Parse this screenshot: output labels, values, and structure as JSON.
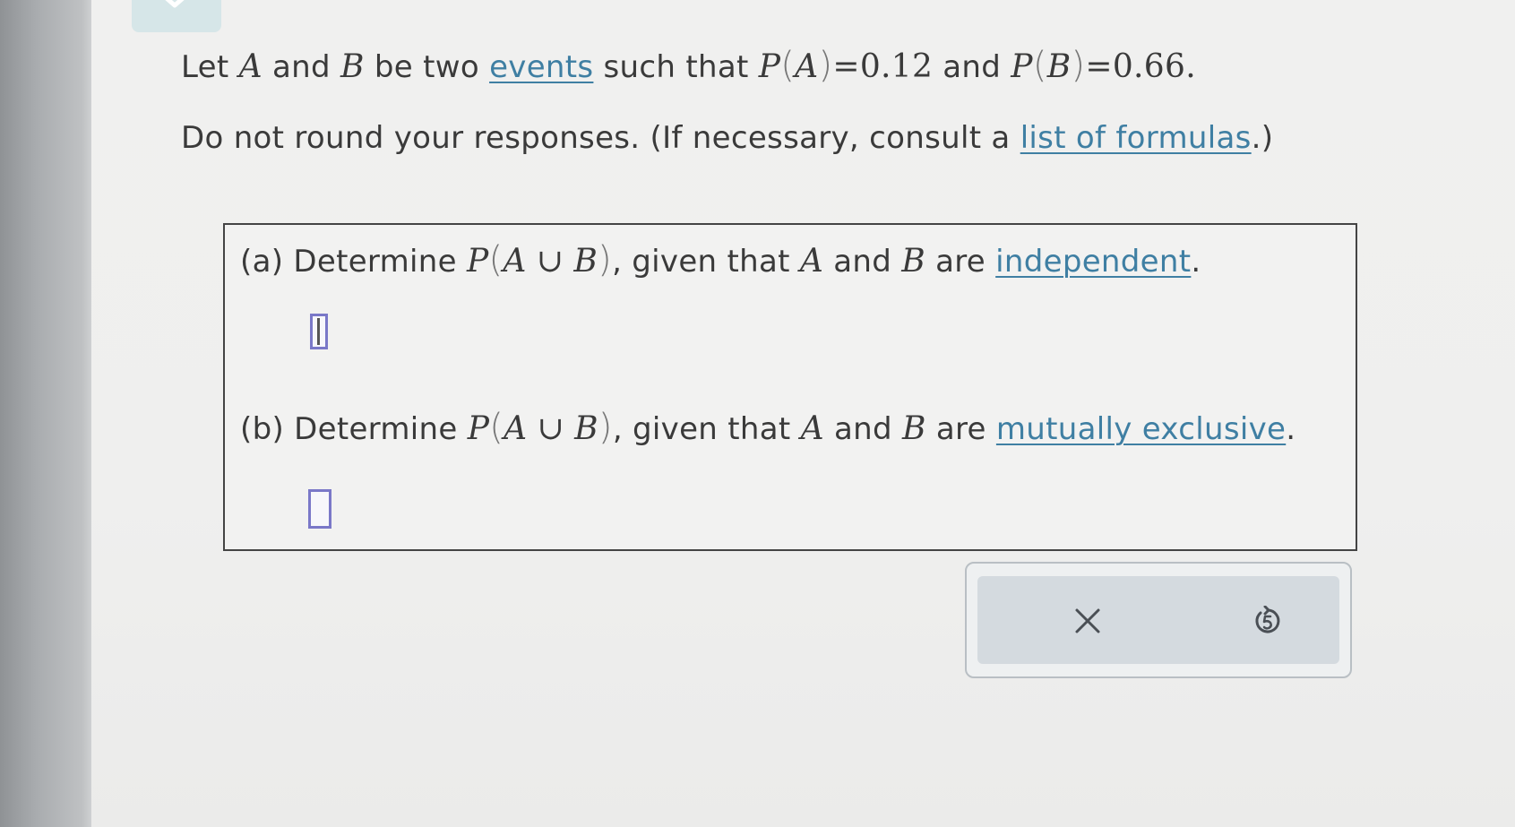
{
  "intro": {
    "let": "Let",
    "var_a": "A",
    "and1": "and",
    "var_b": "B",
    "be_two": "be two",
    "events_link": "events",
    "such_that": "such that",
    "pa_p": "P",
    "pa_a": "A",
    "pa_eq": "=0.12",
    "and2": "and",
    "pb_p": "P",
    "pb_b": "B",
    "pb_eq": "=0.66."
  },
  "instruction": {
    "text": "Do not round your responses. (If necessary, consult a",
    "formulas_link": "list of formulas",
    "tail": ".)"
  },
  "part_a": {
    "label": "(a)",
    "determine": "Determine",
    "p": "P",
    "a": "A",
    "union": "∪",
    "b": "B",
    "given": ", given that",
    "var_a": "A",
    "and": "and",
    "var_b": "B",
    "are": "are",
    "link": "independent",
    "period": "."
  },
  "part_b": {
    "label": "(b)",
    "determine": "Determine",
    "p": "P",
    "a": "A",
    "union": "∪",
    "b": "B",
    "given": ", given that",
    "var_a": "A",
    "and": "and",
    "var_b": "B",
    "are": "are",
    "link": "mutually exclusive",
    "period": "."
  },
  "answers": {
    "a_value": "",
    "b_value": ""
  },
  "buttons": {
    "clear_icon": "x-icon",
    "undo_icon": "undo-icon"
  },
  "colors": {
    "link": "#3f7fa3",
    "answer_border": "#7a78c8",
    "text": "#3a3a3a"
  }
}
